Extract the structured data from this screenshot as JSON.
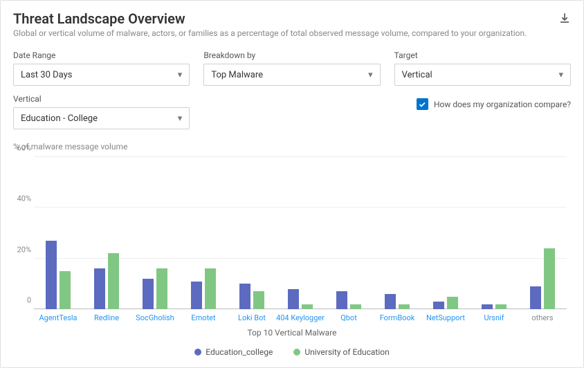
{
  "header": {
    "title": "Threat Landscape Overview",
    "subtitle": "Global or vertical volume of malware, actors, or families as a percentage of total observed message volume, compared to your organization."
  },
  "controls": {
    "date_range": {
      "label": "Date Range",
      "value": "Last 30 Days"
    },
    "breakdown": {
      "label": "Breakdown by",
      "value": "Top Malware"
    },
    "target": {
      "label": "Target",
      "value": "Vertical"
    },
    "vertical": {
      "label": "Vertical",
      "value": "Education - College"
    },
    "compare": {
      "checked": true,
      "label": "How does my organization compare?"
    }
  },
  "chart_data": {
    "type": "bar",
    "title": "Top 10 Vertical Malware",
    "ylabel": "% of malware message volume",
    "ylim": [
      0,
      60
    ],
    "yticks": [
      0,
      20,
      40,
      60
    ],
    "categories": [
      "AgentTesla",
      "Redline",
      "SocGholish",
      "Emotet",
      "Loki Bot",
      "404 Keylogger",
      "Qbot",
      "FormBook",
      "NetSupport",
      "Ursnif",
      "others"
    ],
    "series": [
      {
        "name": "Education_college",
        "color": "#5c6bc0",
        "values": [
          27,
          16,
          12,
          11,
          10,
          8,
          7,
          6,
          3,
          2,
          9
        ]
      },
      {
        "name": "University of Education",
        "color": "#81c784",
        "values": [
          15,
          22,
          16,
          16,
          7,
          2,
          2,
          2,
          5,
          2,
          24
        ]
      }
    ]
  }
}
